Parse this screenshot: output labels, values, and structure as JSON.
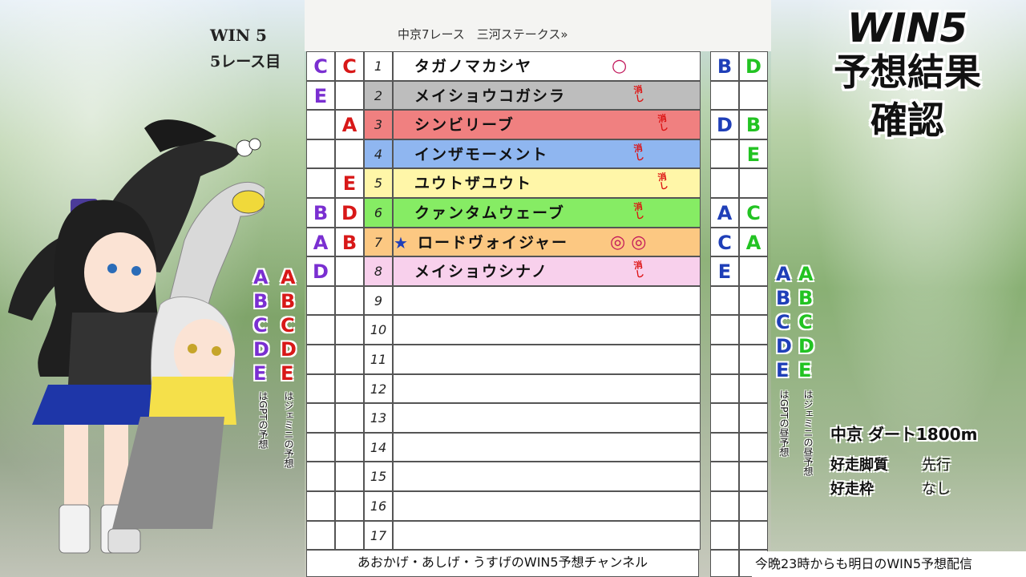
{
  "header": {
    "win5_label": "WIN 5",
    "race_count": "5レース目",
    "race_title": "中京7レース　三河ステークス»"
  },
  "title": {
    "line1": "WIN5",
    "line2": "予想結果",
    "line3": "確認"
  },
  "colors": {
    "purple": "#7a2fd1",
    "red": "#d81818",
    "blue": "#1f3fb8",
    "green": "#22c322"
  },
  "rows": [
    {
      "num": "1",
      "name": "タガノマカシヤ",
      "bg": "#ffffff",
      "gpt_left": "C",
      "gem_left": "C",
      "gpt_right": "B",
      "gem_right": "D",
      "mark": "○",
      "keshi": ""
    },
    {
      "num": "2",
      "name": "メイショウコガシラ",
      "bg": "#bdbdbd",
      "gpt_left": "E",
      "gem_left": "",
      "gpt_right": "",
      "gem_right": "",
      "mark": "",
      "keshi": "消し"
    },
    {
      "num": "3",
      "name": "シンビリーブ",
      "bg": "#f08080",
      "gpt_left": "",
      "gem_left": "A",
      "gpt_right": "D",
      "gem_right": "B",
      "mark": "",
      "keshi": "消し"
    },
    {
      "num": "4",
      "name": "インザモーメント",
      "bg": "#8fb6f0",
      "gpt_left": "",
      "gem_left": "",
      "gpt_right": "",
      "gem_right": "E",
      "mark": "",
      "keshi": "消し"
    },
    {
      "num": "5",
      "name": "ユウトザユウト",
      "bg": "#fff6a8",
      "gpt_left": "",
      "gem_left": "E",
      "gpt_right": "",
      "gem_right": "",
      "mark": "",
      "keshi": "消し"
    },
    {
      "num": "6",
      "name": "クァンタムウェーブ",
      "bg": "#86ec64",
      "gpt_left": "B",
      "gem_left": "D",
      "gpt_right": "A",
      "gem_right": "C",
      "mark": "",
      "keshi": "消し"
    },
    {
      "num": "7",
      "name": "ロードヴォイジャー",
      "bg": "#fcc882",
      "gpt_left": "A",
      "gem_left": "B",
      "gpt_right": "C",
      "gem_right": "A",
      "mark": "◎ ◎",
      "keshi": "",
      "star": "★"
    },
    {
      "num": "8",
      "name": "メイショウシナノ",
      "bg": "#f8d0ec",
      "gpt_left": "D",
      "gem_left": "",
      "gpt_right": "E",
      "gem_right": "",
      "mark": "",
      "keshi": "消し"
    },
    {
      "num": "9",
      "name": "",
      "bg": "#ffffff",
      "gpt_left": "",
      "gem_left": "",
      "gpt_right": "",
      "gem_right": "",
      "mark": "",
      "keshi": ""
    },
    {
      "num": "10",
      "name": "",
      "bg": "#ffffff",
      "gpt_left": "",
      "gem_left": "",
      "gpt_right": "",
      "gem_right": "",
      "mark": "",
      "keshi": ""
    },
    {
      "num": "11",
      "name": "",
      "bg": "#ffffff",
      "gpt_left": "",
      "gem_left": "",
      "gpt_right": "",
      "gem_right": "",
      "mark": "",
      "keshi": ""
    },
    {
      "num": "12",
      "name": "",
      "bg": "#ffffff",
      "gpt_left": "",
      "gem_left": "",
      "gpt_right": "",
      "gem_right": "",
      "mark": "",
      "keshi": ""
    },
    {
      "num": "13",
      "name": "",
      "bg": "#ffffff",
      "gpt_left": "",
      "gem_left": "",
      "gpt_right": "",
      "gem_right": "",
      "mark": "",
      "keshi": ""
    },
    {
      "num": "14",
      "name": "",
      "bg": "#ffffff",
      "gpt_left": "",
      "gem_left": "",
      "gpt_right": "",
      "gem_right": "",
      "mark": "",
      "keshi": ""
    },
    {
      "num": "15",
      "name": "",
      "bg": "#ffffff",
      "gpt_left": "",
      "gem_left": "",
      "gpt_right": "",
      "gem_right": "",
      "mark": "",
      "keshi": ""
    },
    {
      "num": "16",
      "name": "",
      "bg": "#ffffff",
      "gpt_left": "",
      "gem_left": "",
      "gpt_right": "",
      "gem_right": "",
      "mark": "",
      "keshi": ""
    },
    {
      "num": "17",
      "name": "",
      "bg": "#ffffff",
      "gpt_left": "",
      "gem_left": "",
      "gpt_right": "",
      "gem_right": "",
      "mark": "",
      "keshi": ""
    }
  ],
  "legend": {
    "letters": [
      "A",
      "B",
      "C",
      "D",
      "E"
    ],
    "gpt_note": "はGPTの予想",
    "gemini_note": "はジェミニの予想",
    "gpt_note_right": "はGPTの昼予想",
    "gemini_note_right": "はジェミニの昼予想"
  },
  "race_info": {
    "course": "中京 ダート1800m",
    "leg_label": "好走脚質",
    "leg_value": "先行",
    "gate_label": "好走枠",
    "gate_value": "なし"
  },
  "footer": {
    "channel": "あおかげ・あしげ・うすげのWIN5予想チャンネル",
    "ticker": "今晩23時からも明日のWIN5予想配信"
  }
}
